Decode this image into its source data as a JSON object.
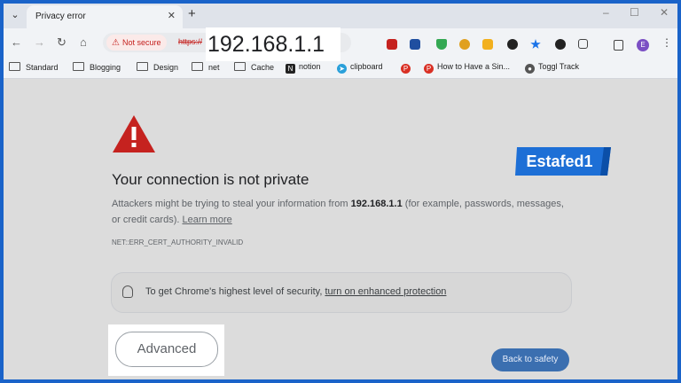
{
  "tab": {
    "title": "Privacy error",
    "close": "✕",
    "menu": "⌄",
    "new_tab": "+"
  },
  "window": {
    "minimize": "–",
    "maximize": "☐",
    "close": "✕"
  },
  "toolbar": {
    "back": "←",
    "forward": "→",
    "reload": "↻",
    "home": "⌂",
    "security_chip": "Not secure",
    "url_scheme": "https://",
    "url_host": "192.168.1.1",
    "avatar_letter": "E",
    "menu": "⋮"
  },
  "bookmarks": [
    {
      "label": "Standard",
      "icon": "folder-icon"
    },
    {
      "label": "Blogging",
      "icon": "folder-icon"
    },
    {
      "label": "Design",
      "icon": "folder-icon"
    },
    {
      "label": "net",
      "icon": "folder-icon"
    },
    {
      "label": "Cache",
      "icon": "folder-icon"
    },
    {
      "label": "notion",
      "icon": "notion-icon"
    },
    {
      "label": "clipboard",
      "icon": "telegram-icon"
    },
    {
      "label": "",
      "icon": "pin-icon"
    },
    {
      "label": "How to Have a Sin...",
      "icon": "pin-icon"
    },
    {
      "label": "Toggl Track",
      "icon": "toggl-icon"
    }
  ],
  "page": {
    "headline": "Your connection is not private",
    "desc_pre": "Attackers might be trying to steal your information from ",
    "desc_host": "192.168.1.1",
    "desc_post": " (for example, passwords, messages, or credit cards). ",
    "learn_more": "Learn more",
    "error_code": "NET::ERR_CERT_AUTHORITY_INVALID",
    "callout_pre": "To get Chrome's highest level of security, ",
    "callout_link": "turn on enhanced protection",
    "advanced_button": "Advanced",
    "back_to_safety": "Back to safety"
  },
  "watermark": {
    "text": "Estafed1"
  },
  "colors": {
    "frame": "#1a63c9",
    "danger": "#c5221f",
    "primary_button": "#3b6fb0",
    "logo": "#1d6fd6"
  }
}
